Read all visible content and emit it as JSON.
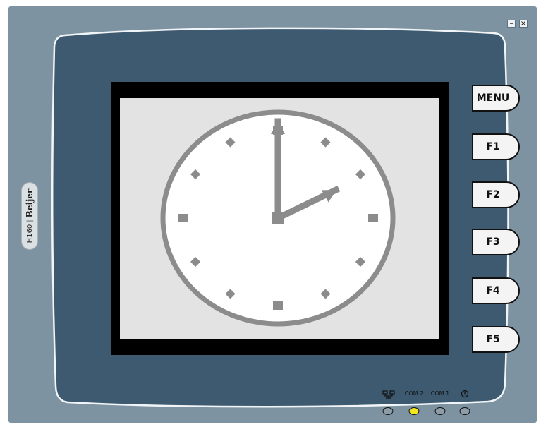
{
  "window": {
    "minimize_glyph": "–",
    "close_glyph": "×"
  },
  "brand": {
    "model": "H160",
    "separator": "|",
    "name": "Beijer"
  },
  "function_keys": [
    {
      "id": "menu",
      "label": "MENU"
    },
    {
      "id": "f1",
      "label": "F1"
    },
    {
      "id": "f2",
      "label": "F2"
    },
    {
      "id": "f3",
      "label": "F3"
    },
    {
      "id": "f4",
      "label": "F4"
    },
    {
      "id": "f5",
      "label": "F5"
    }
  ],
  "status_leds": [
    {
      "id": "network",
      "label": "network-icon",
      "icon": "network-icon",
      "on": false
    },
    {
      "id": "com2",
      "label": "COM 2",
      "on": true
    },
    {
      "id": "com1",
      "label": "COM 1",
      "on": false
    },
    {
      "id": "power",
      "label": "power-icon",
      "icon": "power-icon",
      "on": false
    }
  ],
  "clock": {
    "hours": 2,
    "minutes": 0
  },
  "colors": {
    "frame": "#7d93a2",
    "bezel": "#3d5a70",
    "screen_border": "#000000",
    "screen_bg": "#e3e3e3",
    "clock_gray": "#8c8c8c",
    "led_on": "#f3e61e"
  }
}
